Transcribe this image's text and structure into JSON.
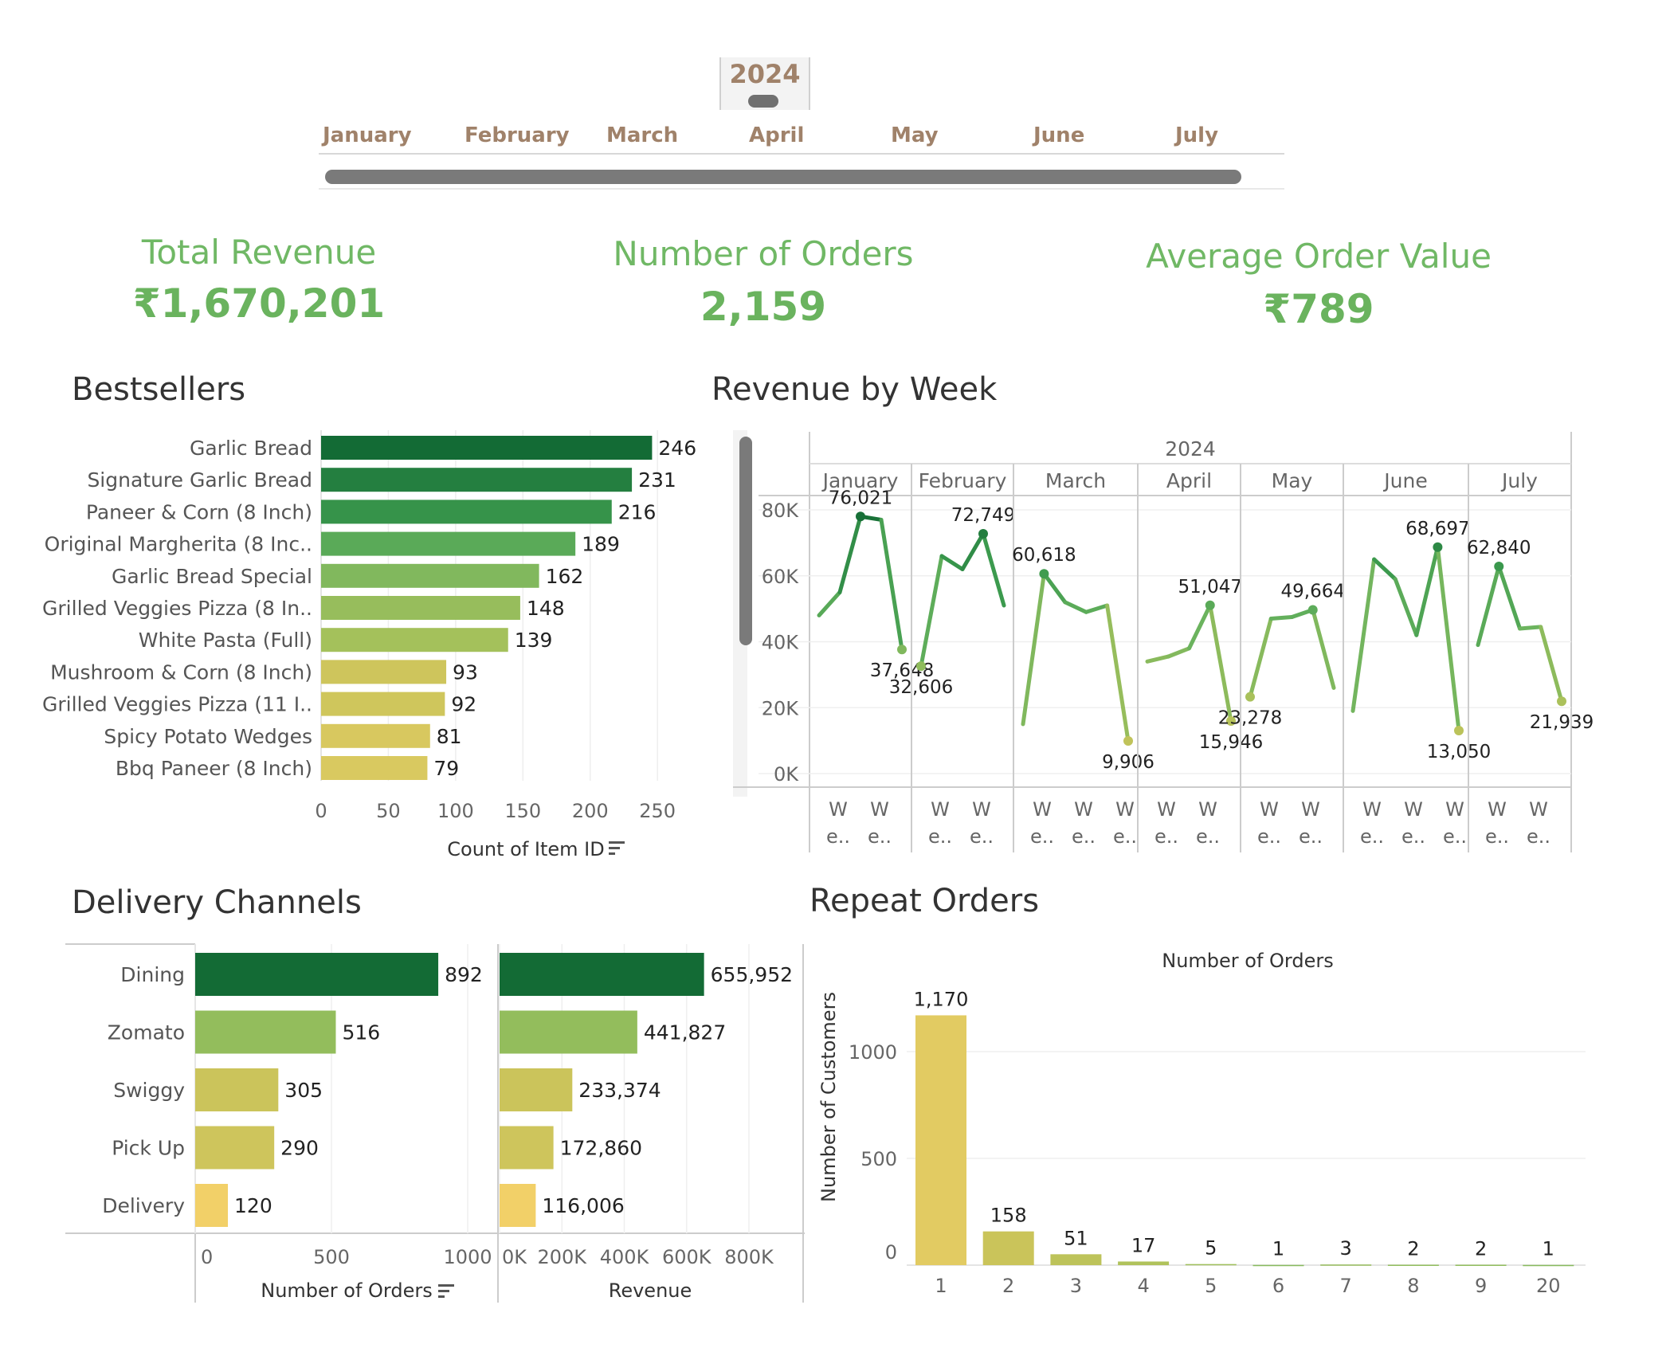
{
  "filter": {
    "year": "2024",
    "months": [
      "January",
      "February",
      "March",
      "April",
      "May",
      "June",
      "July"
    ]
  },
  "kpis": {
    "total_revenue": {
      "label": "Total Revenue",
      "value": "₹1,670,201"
    },
    "orders": {
      "label": "Number of Orders",
      "value": "2,159"
    },
    "aov": {
      "label": "Average Order Value",
      "value": "₹789"
    }
  },
  "sections": {
    "bestsellers": "Bestsellers",
    "revenue_week": "Revenue by Week",
    "delivery": "Delivery Channels",
    "repeat": "Repeat Orders"
  },
  "colors": {
    "dark": "#136b35",
    "light": "#f2d068",
    "accent": "#6ab35e"
  },
  "chart_data": [
    {
      "id": "bestsellers",
      "type": "bar",
      "orientation": "horizontal",
      "categories": [
        "Garlic Bread",
        "Signature Garlic Bread",
        "Paneer & Corn (8 Inch)",
        "Original Margherita (8 Inc..",
        "Garlic Bread Special",
        "Grilled Veggies Pizza (8 In..",
        "White Pasta (Full)",
        "Mushroom & Corn (8 Inch)",
        "Grilled Veggies Pizza (11 I..",
        "Spicy Potato Wedges",
        "Bbq Paneer (8 Inch)"
      ],
      "values": [
        246,
        231,
        216,
        189,
        162,
        148,
        139,
        93,
        92,
        81,
        79
      ],
      "xlabel": "Count of Item ID",
      "xlim": [
        0,
        250
      ],
      "xticks": [
        0,
        50,
        100,
        150,
        200,
        250
      ]
    },
    {
      "id": "revenue_by_week",
      "type": "line",
      "header": "2024",
      "ylim": [
        0,
        80000
      ],
      "yticks": [
        "0K",
        "20K",
        "40K",
        "60K",
        "80K"
      ],
      "week_label": [
        "W",
        "e.."
      ],
      "panels": [
        {
          "month": "January",
          "weeks": 2,
          "values": [
            48000,
            55000,
            78000,
            77000,
            37648
          ],
          "labels": [
            {
              "i": 2,
              "text": "76,021"
            },
            {
              "i": 4,
              "text": "37,648"
            }
          ]
        },
        {
          "month": "February",
          "weeks": 2,
          "values": [
            32606,
            66000,
            62000,
            72749,
            51000
          ],
          "labels": [
            {
              "i": 0,
              "text": "32,606"
            },
            {
              "i": 3,
              "text": "72,749"
            }
          ]
        },
        {
          "month": "March",
          "weeks": 3,
          "values": [
            15000,
            60618,
            52000,
            49000,
            51000,
            9906
          ],
          "labels": [
            {
              "i": 1,
              "text": "60,618"
            },
            {
              "i": 5,
              "text": "9,906"
            }
          ]
        },
        {
          "month": "April",
          "weeks": 2,
          "values": [
            34000,
            35500,
            38000,
            51047,
            15946
          ],
          "labels": [
            {
              "i": 3,
              "text": "51,047"
            },
            {
              "i": 4,
              "text": "15,946"
            }
          ]
        },
        {
          "month": "May",
          "weeks": 2,
          "values": [
            23278,
            47000,
            47500,
            49664,
            26000
          ],
          "labels": [
            {
              "i": 0,
              "text": "23,278"
            },
            {
              "i": 3,
              "text": "49,664"
            }
          ]
        },
        {
          "month": "June",
          "weeks": 3,
          "values": [
            19000,
            65000,
            59000,
            42000,
            68697,
            13050
          ],
          "labels": [
            {
              "i": 4,
              "text": "68,697"
            },
            {
              "i": 5,
              "text": "13,050"
            }
          ]
        },
        {
          "month": "July",
          "weeks": 2,
          "values": [
            39000,
            62840,
            44000,
            44500,
            21939
          ],
          "labels": [
            {
              "i": 1,
              "text": "62,840"
            },
            {
              "i": 4,
              "text": "21,939"
            }
          ]
        }
      ]
    },
    {
      "id": "delivery_orders",
      "type": "bar",
      "orientation": "horizontal",
      "categories": [
        "Dining",
        "Zomato",
        "Swiggy",
        "Pick Up",
        "Delivery"
      ],
      "values": [
        892,
        516,
        305,
        290,
        120
      ],
      "value_labels": [
        "892",
        "516",
        "305",
        "290",
        "120"
      ],
      "xlabel": "Number of Orders",
      "xlim": [
        0,
        1000
      ],
      "xticks": [
        0,
        500,
        1000
      ]
    },
    {
      "id": "delivery_revenue",
      "type": "bar",
      "orientation": "horizontal",
      "categories": [
        "Dining",
        "Zomato",
        "Swiggy",
        "Pick Up",
        "Delivery"
      ],
      "values": [
        655952,
        441827,
        233374,
        172860,
        116006
      ],
      "value_labels": [
        "655,952",
        "441,827",
        "233,374",
        "172,860",
        "116,006"
      ],
      "xlabel": "Revenue",
      "xlim": [
        0,
        800000
      ],
      "xticks": [
        "0K",
        "200K",
        "400K",
        "600K",
        "800K"
      ]
    },
    {
      "id": "repeat_orders",
      "type": "bar",
      "title": "Number of Orders",
      "ylabel": "Number of Customers",
      "categories": [
        "1",
        "2",
        "3",
        "4",
        "5",
        "6",
        "7",
        "8",
        "9",
        "20"
      ],
      "values": [
        1170,
        158,
        51,
        17,
        5,
        1,
        3,
        2,
        2,
        1
      ],
      "value_labels": [
        "1,170",
        "158",
        "51",
        "17",
        "5",
        "1",
        "3",
        "2",
        "2",
        "1"
      ],
      "ylim": [
        0,
        1200
      ],
      "yticks": [
        0,
        500,
        1000
      ]
    }
  ]
}
